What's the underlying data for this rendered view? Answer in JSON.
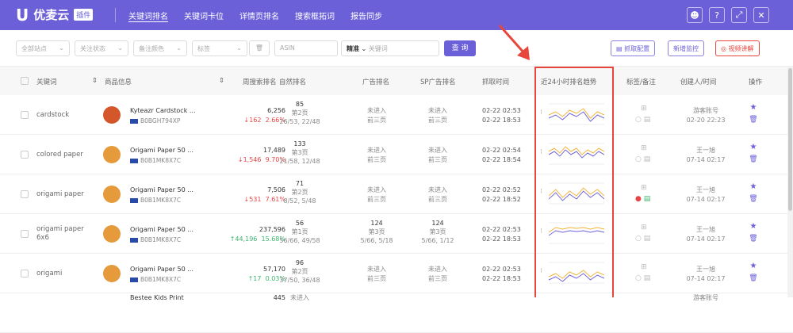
{
  "app": {
    "logo": "U",
    "name": "优麦云",
    "badge": "插件"
  },
  "nav": [
    "关键词排名",
    "关键词卡位",
    "详情页排名",
    "搜索框拓词",
    "报告同步"
  ],
  "filters": {
    "site": "全部站点",
    "follow": "关注状态",
    "note_color": "备注颜色",
    "tag": "标签",
    "asin_placeholder": "ASIN",
    "match": "精准",
    "keyword_placeholder": "关键词",
    "query": "查 询",
    "fetch_config": "抓取配置",
    "new_monitor": "新增监控",
    "video": "视频讲解"
  },
  "headers": [
    "关键词",
    "商品信息",
    "周搜索排名",
    "自然排名",
    "广告排名",
    "SP广告排名",
    "抓取时间",
    "近24小时排名趋势",
    "标签/备注",
    "创建人/时间",
    "操作"
  ],
  "rows": [
    {
      "keyword": "cardstock",
      "product": "Kyteazr Cardstock ...",
      "asin": "B0BGH794XP",
      "weekly": "6,256",
      "delta": "↓162",
      "pct": "2.66%",
      "delta_color": "red",
      "natural": "85",
      "natural_page": "第2页",
      "natural_pos": "26/53, 22/48",
      "ad": "未进入",
      "ad_sub": "前三页",
      "sp": "未进入",
      "sp_sub": "前三页",
      "t1": "02-22 02:53",
      "t2": "02-22 18:53",
      "creator": "游客账号",
      "ctime": "02-20 22:23",
      "note_red": false
    },
    {
      "keyword": "colored paper",
      "product": "Origami Paper 50 ...",
      "asin": "B0B1MK8X7C",
      "weekly": "17,489",
      "delta": "↓1,546",
      "pct": "9.70%",
      "delta_color": "red",
      "natural": "133",
      "natural_page": "第3页",
      "natural_pos": "21/58, 12/48",
      "ad": "未进入",
      "ad_sub": "前三页",
      "sp": "未进入",
      "sp_sub": "前三页",
      "t1": "02-22 02:54",
      "t2": "02-22 18:54",
      "creator": "王一旭",
      "ctime": "07-14 02:17",
      "note_red": false
    },
    {
      "keyword": "origami paper",
      "product": "Origami Paper 50 ...",
      "asin": "B0B1MK8X7C",
      "weekly": "7,506",
      "delta": "↓531",
      "pct": "7.61%",
      "delta_color": "red",
      "natural": "71",
      "natural_page": "第2页",
      "natural_pos": "8/52, 5/48",
      "ad": "未进入",
      "ad_sub": "前三页",
      "sp": "未进入",
      "sp_sub": "前三页",
      "t1": "02-22 02:52",
      "t2": "02-22 18:52",
      "creator": "王一旭",
      "ctime": "07-14 02:17",
      "note_red": true
    },
    {
      "keyword": "origami paper 6x6",
      "product": "Origami Paper 50 ...",
      "asin": "B0B1MK8X7C",
      "weekly": "237,596",
      "delta": "↑44,196",
      "pct": "15.68%",
      "delta_color": "green",
      "natural": "56",
      "natural_page": "第1页",
      "natural_pos": "56/66, 49/58",
      "ad": "124",
      "ad_sub": "第3页",
      "ad_pos": "5/66, 5/18",
      "sp": "124",
      "sp_sub": "第3页",
      "sp_pos": "5/66, 1/12",
      "t1": "02-22 02:53",
      "t2": "02-22 18:53",
      "creator": "王一旭",
      "ctime": "07-14 02:17",
      "note_red": false
    },
    {
      "keyword": "origami",
      "product": "Origami Paper 50 ...",
      "asin": "B0B1MK8X7C",
      "weekly": "57,170",
      "delta": "↑17",
      "pct": "0.03%",
      "delta_color": "green",
      "natural": "96",
      "natural_page": "第2页",
      "natural_pos": "37/50, 36/48",
      "ad": "未进入",
      "ad_sub": "前三页",
      "sp": "未进入",
      "sp_sub": "前三页",
      "t1": "02-22 02:53",
      "t2": "02-22 18:53",
      "creator": "王一旭",
      "ctime": "07-14 02:17",
      "note_red": false
    }
  ],
  "partial_row": {
    "product": "Bestee Kids Print",
    "weekly": "445",
    "natural": "未进入",
    "creator": "游客账号"
  },
  "colors": {
    "brand": "#6b60d8",
    "highlight": "#e8463c",
    "up": "#3cb46e",
    "down": "#e64545",
    "arrow": "#e8463c"
  }
}
